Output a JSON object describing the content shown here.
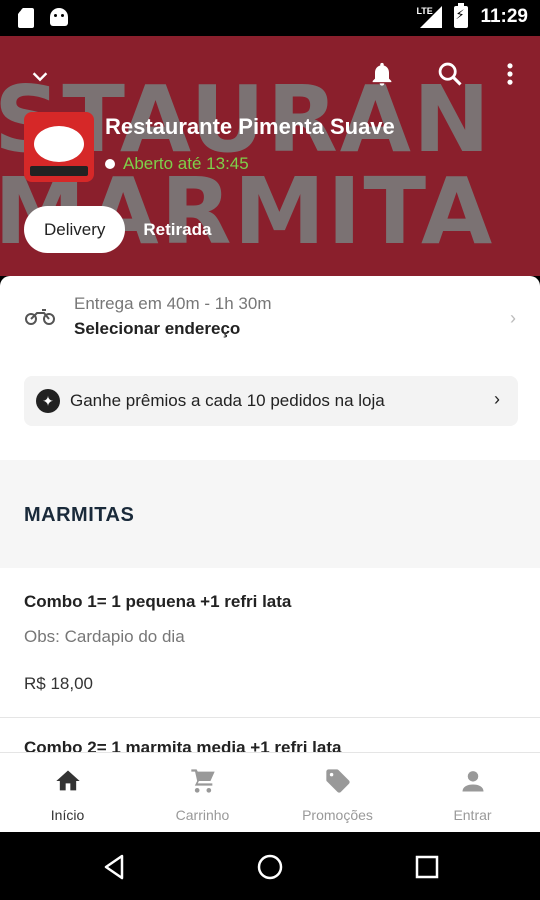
{
  "status_bar": {
    "time": "11:29",
    "network": "LTE"
  },
  "hero": {
    "background_words": [
      "STAURAN",
      "MARMITA"
    ],
    "store_name": "Restaurante Pimenta Suave",
    "open_status": "Aberto até 13:45",
    "tabs": [
      {
        "label": "Delivery",
        "active": true
      },
      {
        "label": "Retirada",
        "active": false
      }
    ]
  },
  "delivery": {
    "time": "Entrega em 40m - 1h 30m",
    "address_label": "Selecionar endereço"
  },
  "rewards": {
    "label": "Ganhe prêmios a cada 10 pedidos na loja"
  },
  "section": {
    "title": "MARMITAS"
  },
  "items": [
    {
      "name": "Combo 1= 1 pequena +1 refri lata",
      "obs": "Obs: Cardapio do dia",
      "price": "R$ 18,00"
    },
    {
      "name": "Combo 2= 1 marmita media +1 refri lata"
    }
  ],
  "bottom_nav": [
    {
      "label": "Início",
      "icon": "home-icon",
      "active": true
    },
    {
      "label": "Carrinho",
      "icon": "cart-icon",
      "active": false
    },
    {
      "label": "Promoções",
      "icon": "tag-icon",
      "active": false
    },
    {
      "label": "Entrar",
      "icon": "person-icon",
      "active": false
    }
  ],
  "colors": {
    "hero_bg": "#8a1f2c",
    "open_green": "#7ed04a",
    "section_title": "#1a2a3a"
  }
}
